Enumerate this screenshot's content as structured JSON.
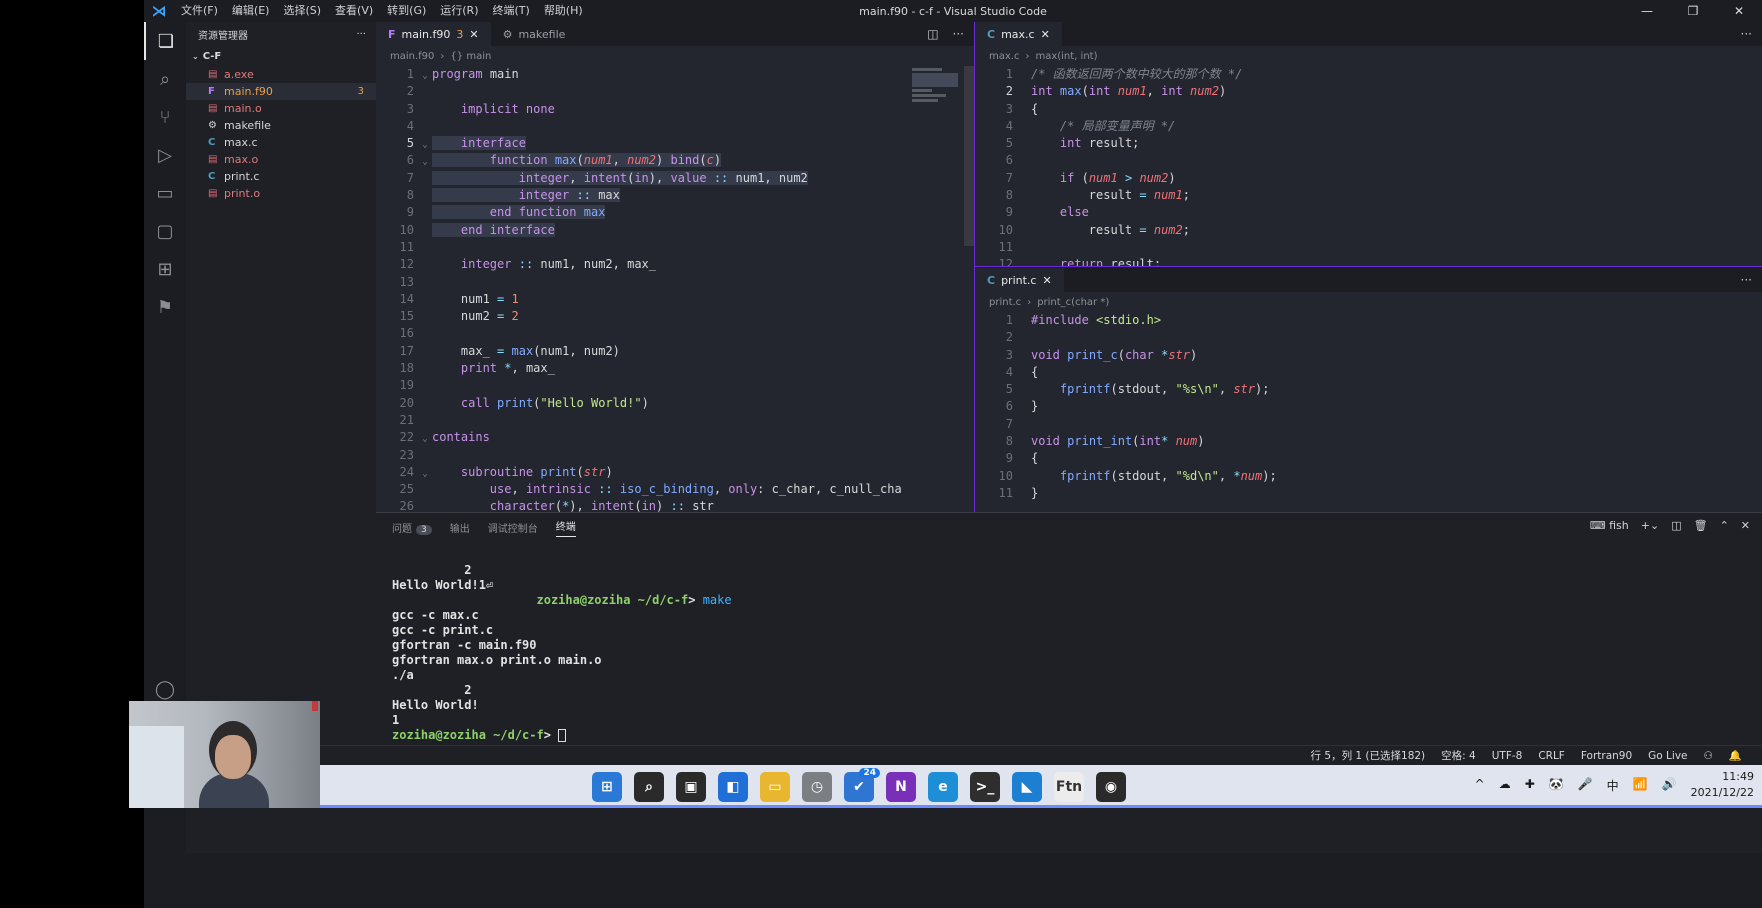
{
  "window": {
    "title": "main.f90 - c-f - Visual Studio Code",
    "menu": [
      "文件(F)",
      "编辑(E)",
      "选择(S)",
      "查看(V)",
      "转到(G)",
      "运行(R)",
      "终端(T)",
      "帮助(H)"
    ]
  },
  "activity_icons": [
    "files-icon",
    "search-icon",
    "source-control-icon",
    "run-debug-icon",
    "folder-icon",
    "remote-explorer-icon",
    "extensions-icon",
    "bookmark-icon",
    "account-icon",
    "settings-icon"
  ],
  "explorer": {
    "title": "资源管理器",
    "folder": "C-F",
    "files": [
      {
        "name": "a.exe",
        "icon": "exe",
        "color": "#e06c75"
      },
      {
        "name": "main.f90",
        "icon": "F",
        "color": "#b57cff",
        "badge": "3",
        "selected": true
      },
      {
        "name": "main.o",
        "icon": "o",
        "color": "#e06c75"
      },
      {
        "name": "makefile",
        "icon": "gear",
        "color": "#d4d6d9"
      },
      {
        "name": "max.c",
        "icon": "C",
        "color": "#519aba"
      },
      {
        "name": "max.o",
        "icon": "o",
        "color": "#e06c75"
      },
      {
        "name": "print.c",
        "icon": "C",
        "color": "#519aba"
      },
      {
        "name": "print.o",
        "icon": "o",
        "color": "#e06c75"
      }
    ]
  },
  "main_editor": {
    "tabs": [
      {
        "label": "main.f90",
        "badge": "3",
        "active": true
      },
      {
        "label": "makefile",
        "active": false
      }
    ],
    "breadcrumb": [
      "main.f90",
      "{} main"
    ],
    "lines": [
      {
        "n": "1",
        "fold": "v",
        "html": "<span class='kw'>program</span> <span class='pl'>main</span>"
      },
      {
        "n": "2",
        "html": ""
      },
      {
        "n": "3",
        "html": "    <span class='kw'>implicit none</span>"
      },
      {
        "n": "4",
        "html": ""
      },
      {
        "n": "5",
        "fold": "v",
        "cur": true,
        "hl": true,
        "html": "    <span class='kw'>interface</span>"
      },
      {
        "n": "6",
        "fold": "v",
        "hl": true,
        "html": "        <span class='kw'>function</span> <span class='fn'>max</span><span class='pl'>(</span><span class='pa'>num1</span><span class='pl'>, </span><span class='pa'>num2</span><span class='pl'>) </span><span class='kw'>bind</span><span class='pl'>(</span><span class='pa'>c</span><span class='pl'>)</span>"
      },
      {
        "n": "7",
        "hl": true,
        "html": "            <span class='kw'>integer</span><span class='pl'>, </span><span class='kw'>intent</span><span class='pl'>(</span><span class='kw'>in</span><span class='pl'>), </span><span class='kw'>value</span> <span class='ops'>::</span> <span class='pl'>num1, num2</span>"
      },
      {
        "n": "8",
        "hl": true,
        "html": "            <span class='kw'>integer</span> <span class='ops'>::</span> <span class='pl'>max</span>"
      },
      {
        "n": "9",
        "hl": true,
        "html": "        <span class='kw'>end function</span> <span class='fn'>max</span>"
      },
      {
        "n": "10",
        "hl": true,
        "html": "    <span class='kw'>end interface</span>"
      },
      {
        "n": "11",
        "html": ""
      },
      {
        "n": "12",
        "html": "    <span class='kw'>integer</span> <span class='ops'>::</span> <span class='pl'>num1, num2, max_</span>"
      },
      {
        "n": "13",
        "html": ""
      },
      {
        "n": "14",
        "html": "    <span class='pl'>num1</span> <span class='ops'>=</span> <span class='num'>1</span>"
      },
      {
        "n": "15",
        "html": "    <span class='pl'>num2</span> <span class='ops'>=</span> <span class='num'>2</span>"
      },
      {
        "n": "16",
        "html": ""
      },
      {
        "n": "17",
        "html": "    <span class='pl'>max_</span> <span class='ops'>=</span> <span class='fn'>max</span><span class='pl'>(num1, num2)</span>"
      },
      {
        "n": "18",
        "html": "    <span class='kw'>print</span> <span class='ops'>*</span><span class='pl'>, max_</span>"
      },
      {
        "n": "19",
        "html": ""
      },
      {
        "n": "20",
        "html": "    <span class='kw'>call</span> <span class='fn'>print</span><span class='pl'>(</span><span class='str'>\"Hello World!\"</span><span class='pl'>)</span>"
      },
      {
        "n": "21",
        "html": ""
      },
      {
        "n": "22",
        "fold": "v",
        "html": "<span class='kw'>contains</span>"
      },
      {
        "n": "23",
        "html": ""
      },
      {
        "n": "24",
        "fold": "v",
        "html": "    <span class='kw'>subroutine</span> <span class='fn'>print</span><span class='pl'>(</span><span class='pa'>str</span><span class='pl'>)</span>"
      },
      {
        "n": "25",
        "html": "        <span class='kw'>use</span><span class='pl'>, </span><span class='kw'>intrinsic</span> <span class='ops'>::</span> <span class='fn'>iso_c_binding</span><span class='pl'>, </span><span class='kw'>only</span><span class='pl'>: c_char, c_null_cha</span>"
      },
      {
        "n": "26",
        "html": "        <span class='kw'>character</span><span class='pl'>(</span><span class='ops'>*</span><span class='pl'>), </span><span class='kw'>intent</span><span class='pl'>(</span><span class='kw'>in</span><span class='pl'>)</span> <span class='ops'>::</span> <span class='pl'>str</span>"
      }
    ]
  },
  "max_editor": {
    "tab": "max.c",
    "breadcrumb": [
      "max.c",
      "max(int, int)"
    ],
    "lines": [
      {
        "n": "1",
        "html": "<span class='cm'>/* 函数返回两个数中较大的那个数 */</span>"
      },
      {
        "n": "2",
        "cur": true,
        "html": "<span class='kw'>int</span> <span class='fn'>max</span><span class='pl'>(</span><span class='kw'>int</span> <span class='pa'>num1</span><span class='pl'>, </span><span class='kw'>int</span> <span class='pa'>num2</span><span class='pl'>)</span>"
      },
      {
        "n": "3",
        "html": "<span class='pl'>{</span>"
      },
      {
        "n": "4",
        "html": "    <span class='cm'>/* 局部变量声明 */</span>"
      },
      {
        "n": "5",
        "html": "    <span class='kw'>int</span> <span class='pl'>result;</span>"
      },
      {
        "n": "6",
        "html": ""
      },
      {
        "n": "7",
        "html": "    <span class='kw'>if</span> <span class='pl'>(</span><span class='pa'>num1</span> <span class='ops'>&gt;</span> <span class='pa'>num2</span><span class='pl'>)</span>"
      },
      {
        "n": "8",
        "html": "        <span class='pl'>result</span> <span class='ops'>=</span> <span class='pa'>num1</span><span class='pl'>;</span>"
      },
      {
        "n": "9",
        "html": "    <span class='kw'>else</span>"
      },
      {
        "n": "10",
        "html": "        <span class='pl'>result</span> <span class='ops'>=</span> <span class='pa'>num2</span><span class='pl'>;</span>"
      },
      {
        "n": "11",
        "html": ""
      },
      {
        "n": "12",
        "html": "    <span class='kw'>return</span> <span class='pl'>result;</span>"
      }
    ]
  },
  "print_editor": {
    "tab": "print.c",
    "breadcrumb": [
      "print.c",
      "print_c(char *)"
    ],
    "lines": [
      {
        "n": "1",
        "html": "<span class='mac'>#include</span> <span class='str'>&lt;stdio.h&gt;</span>"
      },
      {
        "n": "2",
        "html": ""
      },
      {
        "n": "3",
        "html": "<span class='kw'>void</span> <span class='fn'>print_c</span><span class='pl'>(</span><span class='kw'>char</span> <span class='ops'>*</span><span class='pa'>str</span><span class='pl'>)</span>"
      },
      {
        "n": "4",
        "html": "<span class='pl'>{</span>"
      },
      {
        "n": "5",
        "html": "    <span class='fn'>fprintf</span><span class='pl'>(stdout, </span><span class='str'>\"%s\\n\"</span><span class='pl'>, </span><span class='pa'>str</span><span class='pl'>);</span>"
      },
      {
        "n": "6",
        "html": "<span class='pl'>}</span>"
      },
      {
        "n": "7",
        "html": ""
      },
      {
        "n": "8",
        "html": "<span class='kw'>void</span> <span class='fn'>print_int</span><span class='pl'>(</span><span class='kw'>int</span><span class='ops'>*</span> <span class='pa'>num</span><span class='pl'>)</span>"
      },
      {
        "n": "9",
        "html": "<span class='pl'>{</span>"
      },
      {
        "n": "10",
        "html": "    <span class='fn'>fprintf</span><span class='pl'>(stdout, </span><span class='str'>\"%d\\n\"</span><span class='pl'>, </span><span class='ops'>*</span><span class='pa'>num</span><span class='pl'>);</span>"
      },
      {
        "n": "11",
        "html": "<span class='pl'>}</span>"
      }
    ]
  },
  "panel": {
    "tabs": [
      "问题",
      "输出",
      "调试控制台",
      "终端"
    ],
    "problems_count": "3",
    "active_tab": "终端",
    "shell": "fish",
    "terminal_lines": [
      {
        "html": "          2"
      },
      {
        "html": "Hello World!1⏎"
      },
      {
        "html": "                    <span class='tg'>zoziha@zoziha</span> <span class='tg'>~/d/c-f</span>&gt; <span class='tc'>make</span>"
      },
      {
        "html": "gcc -c max.c"
      },
      {
        "html": "gcc -c print.c"
      },
      {
        "html": "gfortran -c main.f90"
      },
      {
        "html": "gfortran max.o print.o main.o"
      },
      {
        "html": "./a"
      },
      {
        "html": "          2"
      },
      {
        "html": "Hello World!"
      },
      {
        "html": "1"
      },
      {
        "html": "<span class='tg'>zoziha@zoziha</span> <span class='tg'>~/d/c-f</span>&gt; <span class='cursor'></span>"
      }
    ]
  },
  "status": {
    "items": [
      "行 5，列 1 (已选择182)",
      "空格: 4",
      "UTF-8",
      "CRLF",
      "Fortran90",
      "Go Live"
    ]
  },
  "taskbar": {
    "apps": [
      {
        "name": "windows-start-icon",
        "label": "⊞",
        "bg": "#2b79d6"
      },
      {
        "name": "search-icon",
        "label": "⌕",
        "bg": "#2a2a2a"
      },
      {
        "name": "task-view-icon",
        "label": "▣",
        "bg": "#2a2a2a"
      },
      {
        "name": "widgets-icon",
        "label": "◧",
        "bg": "#1f6fd6"
      },
      {
        "name": "file-explorer-icon",
        "label": "▭",
        "bg": "#e8b72f"
      },
      {
        "name": "clock-app-icon",
        "label": "◷",
        "bg": "#7b7f84"
      },
      {
        "name": "todo-icon",
        "label": "✔",
        "bg": "#2f76d2",
        "count": "24"
      },
      {
        "name": "onenote-icon",
        "label": "N",
        "bg": "#7a2fb8"
      },
      {
        "name": "edge-icon",
        "label": "e",
        "bg": "#1e8fd6"
      },
      {
        "name": "terminal-icon",
        "label": ">_",
        "bg": "#2e2e2e"
      },
      {
        "name": "vscode-icon",
        "label": "◣",
        "bg": "#1d7fd1"
      },
      {
        "name": "ftn-app-icon",
        "label": "Ftn",
        "bg": "#ececec"
      },
      {
        "name": "steam-icon",
        "label": "◉",
        "bg": "#2a2a2a"
      }
    ],
    "tray": [
      "^",
      "☁",
      "✚",
      "🐼",
      "🎤",
      "中",
      "📶",
      "🔊"
    ],
    "time": "11:49",
    "date": "2021/12/22"
  }
}
